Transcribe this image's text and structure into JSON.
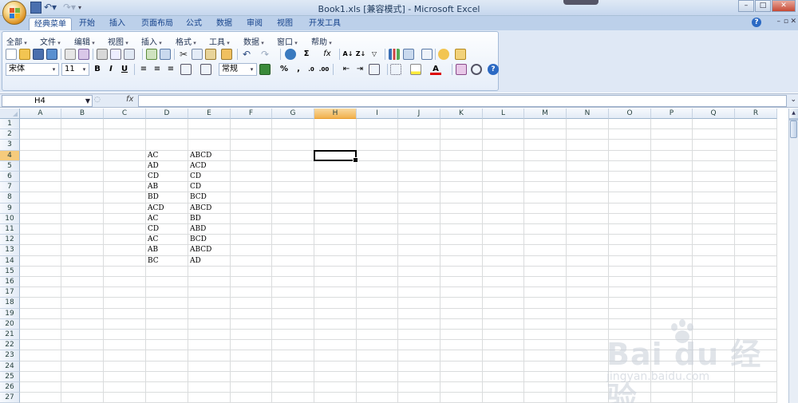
{
  "window": {
    "title": "Book1.xls  [兼容模式] - Microsoft Excel",
    "buttons": [
      "–",
      "□",
      "✕"
    ]
  },
  "tabs": [
    "经典菜单",
    "开始",
    "插入",
    "页面布局",
    "公式",
    "数据",
    "审阅",
    "视图",
    "开发工具"
  ],
  "classic_menu": [
    "全部",
    "文件",
    "编辑",
    "视图",
    "插入",
    "格式",
    "工具",
    "数据",
    "窗口",
    "帮助"
  ],
  "toolbar": {
    "font_name": "宋体",
    "font_size": "11",
    "bold": "B",
    "italic": "I",
    "underline": "U",
    "number_format": "常规",
    "percent": "%",
    "comma": ",",
    "sum": "Σ",
    "fx": "fx"
  },
  "formula_bar": {
    "name_box": "H4",
    "fx_label": "fx",
    "formula": ""
  },
  "sheet": {
    "columns": [
      "A",
      "B",
      "C",
      "D",
      "E",
      "F",
      "G",
      "H",
      "I",
      "J",
      "K",
      "L",
      "M",
      "N",
      "O",
      "P",
      "Q",
      "R"
    ],
    "rows": [
      "1",
      "2",
      "3",
      "4",
      "5",
      "6",
      "7",
      "8",
      "9",
      "10",
      "11",
      "12",
      "13",
      "14",
      "15",
      "16",
      "17",
      "18",
      "19",
      "20",
      "21",
      "22",
      "23",
      "24",
      "25",
      "26",
      "27"
    ],
    "selected_column": "H",
    "selected_row": "4",
    "data": {
      "D": [
        "AC",
        "AD",
        "CD",
        "AB",
        "BD",
        "ACD",
        "AC",
        "CD",
        "AC",
        "AB",
        "BC"
      ],
      "E": [
        "ABCD",
        "ACD",
        "CD",
        "CD",
        "BCD",
        "ABCD",
        "BD",
        "ABD",
        "BCD",
        "ABCD",
        "AD"
      ]
    },
    "data_start_row": 4
  },
  "watermark": {
    "text": "Bai du 经验",
    "sub": "jingyan.baidu.com"
  },
  "colors": {
    "title_text": "#1e395b",
    "tab_text": "#15428b",
    "selected_header": "#f1b14e",
    "grid_line": "#dadcdd"
  }
}
